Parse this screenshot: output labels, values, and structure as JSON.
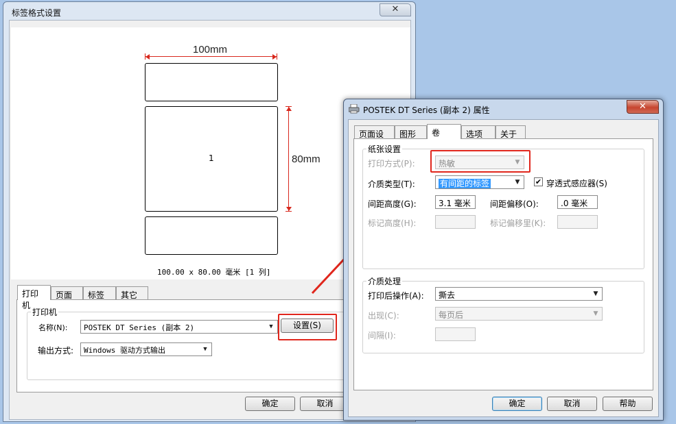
{
  "bg_window": {
    "title": "标签格式设置",
    "close_glyph": "✕",
    "preview": {
      "width_label": "100mm",
      "height_label": "80mm",
      "label_number": "1",
      "summary": "100.00 x 80.00 毫米 [1 列]"
    },
    "tabs": [
      "打印机",
      "页面",
      "标签",
      "其它"
    ],
    "printer_group": "打印机",
    "name_label": "名称(N):",
    "name_value": "POSTEK DT Series (副本 2)",
    "setup_button": "设置(S)",
    "output_label": "输出方式:",
    "output_value": "Windows 驱动方式输出",
    "ok_button": "确定",
    "cancel_button": "取消"
  },
  "dialog": {
    "title": "POSTEK DT Series (副本 2) 属性",
    "close_glyph": "✕",
    "tabs": [
      "页面设置",
      "图形",
      "卷",
      "选项",
      "关于"
    ],
    "paper_group": "纸张设置",
    "print_method_label": "打印方式(P):",
    "print_method_value": "热敏",
    "media_type_label": "介质类型(T):",
    "media_type_value": "有间距的标签",
    "transmissive_checked": "✔",
    "transmissive_label": "穿透式感应器(S)",
    "gap_height_label": "间距高度(G):",
    "gap_height_value": "3.1 毫米",
    "gap_offset_label": "间距偏移(O):",
    "gap_offset_value": ".0 毫米",
    "mark_height_label": "标记高度(H):",
    "mark_offset_label": "标记偏移里(K):",
    "media_handling_group": "介质处理",
    "post_print_label": "打印后操作(A):",
    "post_print_value": "撕去",
    "occur_label": "出现(C):",
    "occur_value": "每页后",
    "interval_label": "间隔(I):",
    "ok_button": "确定",
    "cancel_button": "取消",
    "help_button": "帮助"
  },
  "colors": {
    "highlight_red": "#e0261c",
    "dimension_red": "#d8271c",
    "selection_blue": "#3399ff",
    "desktop": "#a9c6e8"
  }
}
